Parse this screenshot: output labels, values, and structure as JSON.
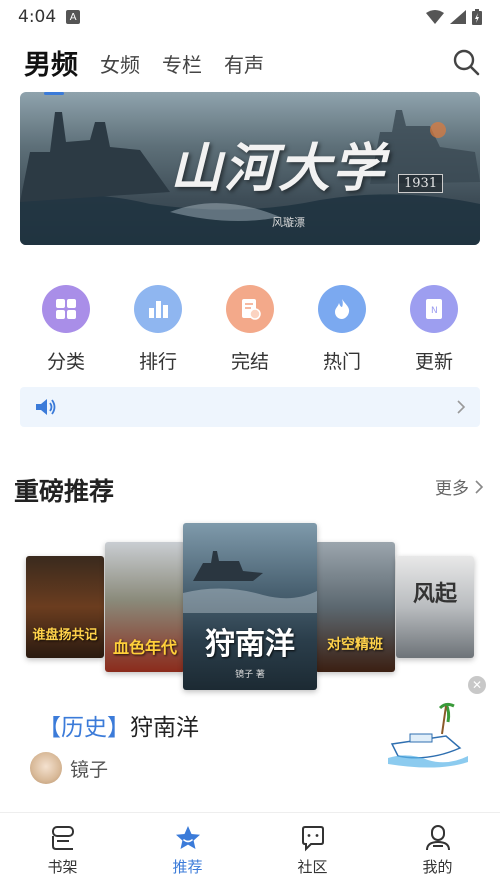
{
  "status_bar": {
    "time": "4:04",
    "a_badge": "A"
  },
  "top_tabs": [
    {
      "label": "男频",
      "active": true
    },
    {
      "label": "女频",
      "active": false
    },
    {
      "label": "专栏",
      "active": false
    },
    {
      "label": "有声",
      "active": false
    }
  ],
  "banner": {
    "title": "山河大学",
    "year": "1931",
    "author": "风璇漂"
  },
  "categories": [
    {
      "label": "分类",
      "icon": "grid-icon",
      "color": "#a98ee8"
    },
    {
      "label": "排行",
      "icon": "bar-chart-icon",
      "color": "#8fb6f0"
    },
    {
      "label": "完结",
      "icon": "document-check-icon",
      "color": "#f3a98a"
    },
    {
      "label": "热门",
      "icon": "flame-icon",
      "color": "#7ba9f0"
    },
    {
      "label": "更新",
      "icon": "book-icon",
      "color": "#9d9ef0"
    }
  ],
  "notice": {
    "icon": "speaker-icon",
    "text": ""
  },
  "section": {
    "title": "重磅推荐",
    "more": "更多"
  },
  "covers": [
    {
      "title": "谁盘扬共记",
      "sub": ""
    },
    {
      "title": "血色年代",
      "sub": ""
    },
    {
      "title": "狩南洋",
      "sub": "镜子 著"
    },
    {
      "title": "对空精班",
      "sub": ""
    },
    {
      "title": "风起",
      "sub": ""
    }
  ],
  "featured": {
    "tag": "【历史】",
    "title": "狩南洋",
    "author": "镜子"
  },
  "bottom_nav": [
    {
      "label": "书架",
      "icon": "bookshelf-icon",
      "active": false
    },
    {
      "label": "推荐",
      "icon": "star-icon",
      "active": true
    },
    {
      "label": "社区",
      "icon": "chat-icon",
      "active": false
    },
    {
      "label": "我的",
      "icon": "person-icon",
      "active": false
    }
  ],
  "colors": {
    "accent": "#3b7bd9"
  }
}
